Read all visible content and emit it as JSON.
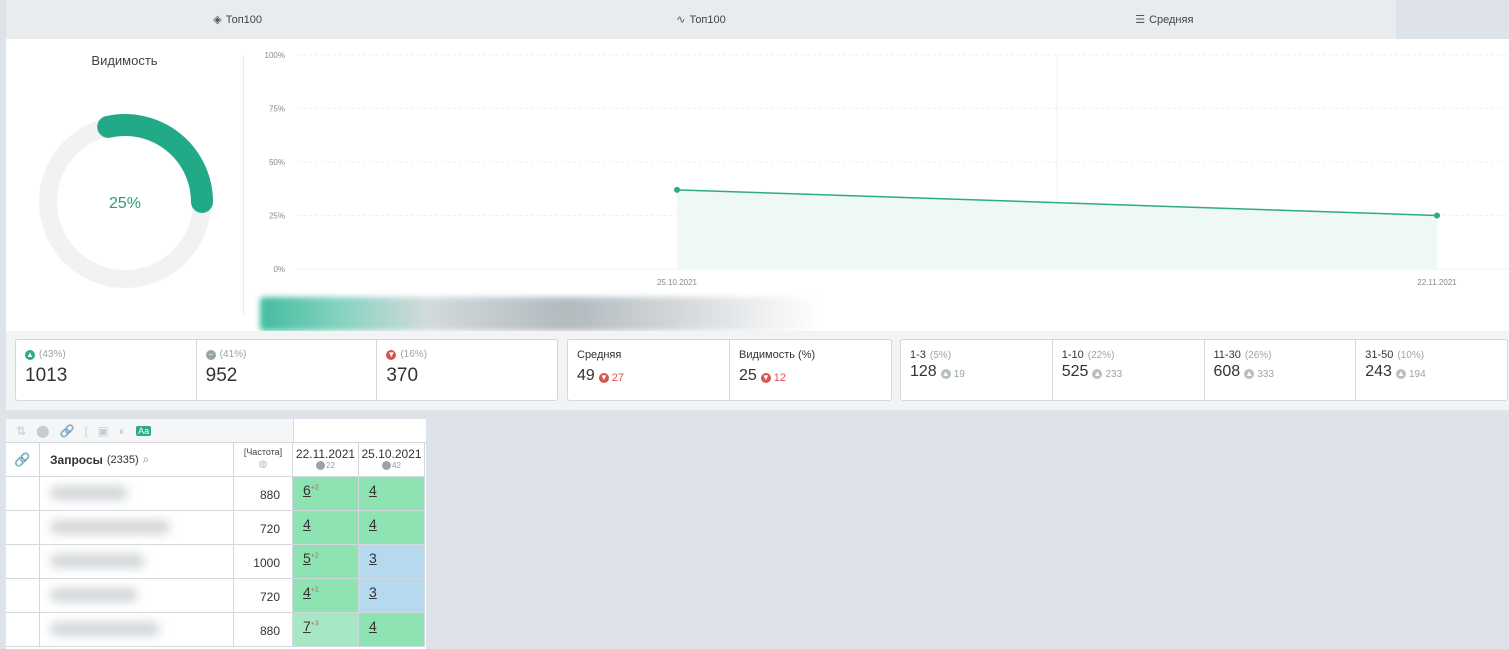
{
  "tabs": [
    {
      "icon": "layers-icon",
      "glyph": "◈",
      "label": "Топ100"
    },
    {
      "icon": "trend-icon",
      "glyph": "∿",
      "label": "Топ100"
    },
    {
      "icon": "list-icon",
      "glyph": "☰",
      "label": "Средняя"
    }
  ],
  "visibility": {
    "title": "Видимость",
    "value_label": "25%",
    "value": 25
  },
  "chart_data": {
    "type": "area",
    "x": [
      "25.10.2021",
      "22.11.2021"
    ],
    "values": [
      37,
      25
    ],
    "ylim": [
      0,
      100
    ],
    "yticks": [
      "0%",
      "25%",
      "50%",
      "75%",
      "100%"
    ],
    "grid": true,
    "color": "#2eaa88"
  },
  "stats": {
    "changes": [
      {
        "icon": "up-arrow-icon",
        "pct": "(43%)",
        "value": "1013"
      },
      {
        "icon": "minus-icon",
        "pct": "(41%)",
        "value": "952"
      },
      {
        "icon": "down-arrow-icon",
        "pct": "(16%)",
        "value": "370"
      }
    ],
    "avg": {
      "label": "Средняя",
      "value": "49",
      "delta": "27"
    },
    "visibility": {
      "label": "Видимость (%)",
      "value": "25",
      "delta": "12"
    },
    "ranges": [
      {
        "label": "1-3",
        "pct": "(5%)",
        "value": "128",
        "delta": "19"
      },
      {
        "label": "1-10",
        "pct": "(22%)",
        "value": "525",
        "delta": "233"
      },
      {
        "label": "11-30",
        "pct": "(26%)",
        "value": "608",
        "delta": "333"
      },
      {
        "label": "31-50",
        "pct": "(10%)",
        "value": "243",
        "delta": "194"
      }
    ]
  },
  "table": {
    "queries_label": "Запросы",
    "queries_count": "(2335)",
    "freq_label": "[Частота]",
    "date_cols": [
      {
        "date": "22.11.2021",
        "sub": "22"
      },
      {
        "date": "25.10.2021",
        "sub": "42"
      }
    ],
    "rows": [
      {
        "freq": "880",
        "p1": "6",
        "d1": "+2",
        "p2": "4",
        "c1": "green1",
        "c2": "green1"
      },
      {
        "freq": "720",
        "p1": "4",
        "d1": "",
        "p2": "4",
        "c1": "green1",
        "c2": "green1"
      },
      {
        "freq": "1000",
        "p1": "5",
        "d1": "+2",
        "p2": "3",
        "c1": "green1",
        "c2": "blue1"
      },
      {
        "freq": "720",
        "p1": "4",
        "d1": "+1",
        "p2": "3",
        "c1": "green1",
        "c2": "blue1"
      },
      {
        "freq": "880",
        "p1": "7",
        "d1": "+3",
        "p2": "4",
        "c1": "green2",
        "c2": "green1"
      }
    ]
  }
}
